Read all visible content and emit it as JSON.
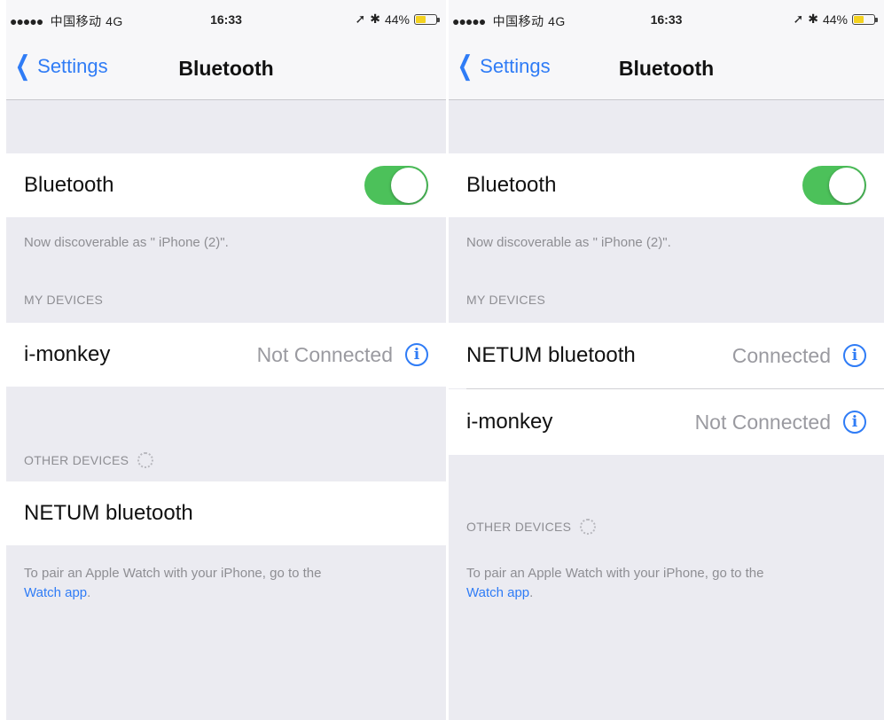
{
  "status_bar": {
    "signal": "●●●●●",
    "carrier": "中国移动",
    "network": "4G",
    "time": "16:33",
    "location_glyph": "➚",
    "bluetooth_glyph": "✱",
    "battery_percent": "44%",
    "battery_level": 0.44,
    "battery_color": "#f4d21f"
  },
  "nav": {
    "back_label": "Settings",
    "title": "Bluetooth"
  },
  "colors": {
    "accent": "#2f7cf6",
    "switch_on": "#4cc15a"
  },
  "left": {
    "bluetooth_label": "Bluetooth",
    "bluetooth_on": true,
    "discoverable": "Now discoverable as \" iPhone (2)\".",
    "my_devices_header": "MY DEVICES",
    "my_devices": [
      {
        "name": "i-monkey",
        "status": "Not Connected"
      }
    ],
    "other_devices_header": "OTHER DEVICES",
    "other_devices": [
      {
        "name": "NETUM bluetooth"
      }
    ],
    "footer_text": "To pair an Apple Watch with your iPhone, go to the",
    "footer_link": "Watch app",
    "footer_end": "."
  },
  "right": {
    "bluetooth_label": "Bluetooth",
    "bluetooth_on": true,
    "discoverable": "Now discoverable as \" iPhone (2)\".",
    "my_devices_header": "MY DEVICES",
    "my_devices": [
      {
        "name": "NETUM bluetooth",
        "status": "Connected"
      },
      {
        "name": "i-monkey",
        "status": "Not Connected"
      }
    ],
    "other_devices_header": "OTHER DEVICES",
    "footer_text": "To pair an Apple Watch with your iPhone, go to the",
    "footer_link": "Watch app",
    "footer_end": "."
  }
}
